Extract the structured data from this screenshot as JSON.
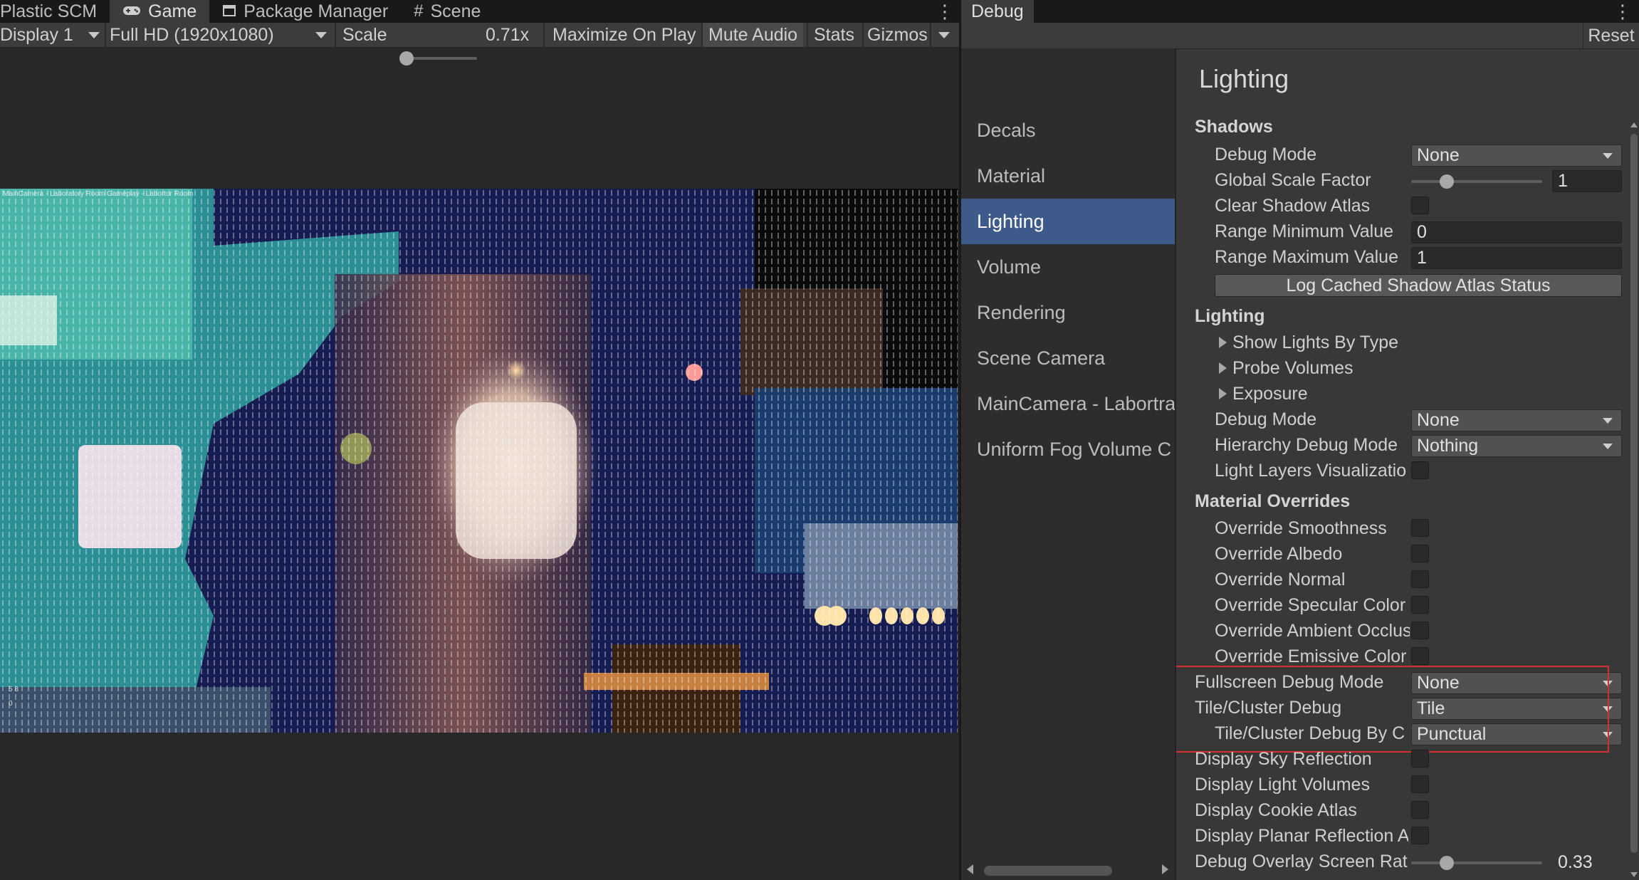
{
  "game_window": {
    "tabs": [
      {
        "label": "Plastic SCM",
        "icon": "plastic-scm-icon"
      },
      {
        "label": "Game",
        "icon": "gamepad-icon",
        "active": true
      },
      {
        "label": "Package Manager",
        "icon": "package-icon"
      },
      {
        "label": "Scene",
        "icon": "grid-hash-icon"
      }
    ],
    "toolbar": {
      "display": "Display 1",
      "resolution": "Full HD (1920x1080)",
      "scale_label": "Scale",
      "scale_value": "0.71x",
      "scale_fraction": 0.05,
      "maximize_on_play": "Maximize On Play",
      "mute_audio": "Mute Audio",
      "stats": "Stats",
      "gizmos": "Gizmos"
    },
    "viewport": {
      "camera_label": "MainCamera - Laboratory Room Gameplay - Labortor Room",
      "stat_text_1": "5 8",
      "stat_text_2": "0"
    }
  },
  "debug_window": {
    "tab_label": "Debug",
    "reset_label": "Reset",
    "nav_items": [
      {
        "label": "Decals",
        "selected": false
      },
      {
        "label": "Material",
        "selected": false
      },
      {
        "label": "Lighting",
        "selected": true
      },
      {
        "label": "Volume",
        "selected": false
      },
      {
        "label": "Rendering",
        "selected": false
      },
      {
        "label": "Scene Camera",
        "selected": false
      },
      {
        "label": "MainCamera - Labortra",
        "selected": false
      },
      {
        "label": "Uniform Fog Volume C",
        "selected": false
      }
    ],
    "panel_title": "Lighting",
    "shadows": {
      "header": "Shadows",
      "debug_mode_label": "Debug Mode",
      "debug_mode_value": "None",
      "global_scale_label": "Global Scale Factor",
      "global_scale_value": "1",
      "global_scale_fraction": 0.27,
      "clear_atlas_label": "Clear Shadow Atlas",
      "range_min_label": "Range Minimum Value",
      "range_min_value": "0",
      "range_max_label": "Range Maximum Value",
      "range_max_value": "1",
      "log_button": "Log Cached Shadow Atlas Status"
    },
    "lighting": {
      "header": "Lighting",
      "show_lights": "Show Lights By Type",
      "probe_volumes": "Probe Volumes",
      "exposure": "Exposure",
      "debug_mode_label": "Debug Mode",
      "debug_mode_value": "None",
      "hierarchy_label": "Hierarchy Debug Mode",
      "hierarchy_value": "Nothing",
      "light_layers_label": "Light Layers Visualizatio"
    },
    "material_overrides": {
      "header": "Material Overrides",
      "items": [
        "Override Smoothness",
        "Override Albedo",
        "Override Normal",
        "Override Specular Color",
        "Override Ambient Occlus",
        "Override Emissive Color"
      ]
    },
    "fullscreen": {
      "fullscreen_label": "Fullscreen Debug Mode",
      "fullscreen_value": "None",
      "tile_cluster_label": "Tile/Cluster Debug",
      "tile_cluster_value": "Tile",
      "tile_cluster_by_label": "Tile/Cluster Debug By C",
      "tile_cluster_by_value": "Punctual"
    },
    "display": {
      "sky_reflection": "Display Sky Reflection",
      "light_volumes": "Display Light Volumes",
      "cookie_atlas": "Display Cookie Atlas",
      "planar_reflection": "Display Planar Reflection A",
      "overlay_ratio_label": "Debug Overlay Screen Rat",
      "overlay_ratio_value": "0.33",
      "overlay_ratio_fraction": 0.27
    }
  },
  "colors": {
    "selected_nav": "#3d5a8a",
    "highlight_box": "#d32f2f",
    "panel_bg": "#383838"
  }
}
